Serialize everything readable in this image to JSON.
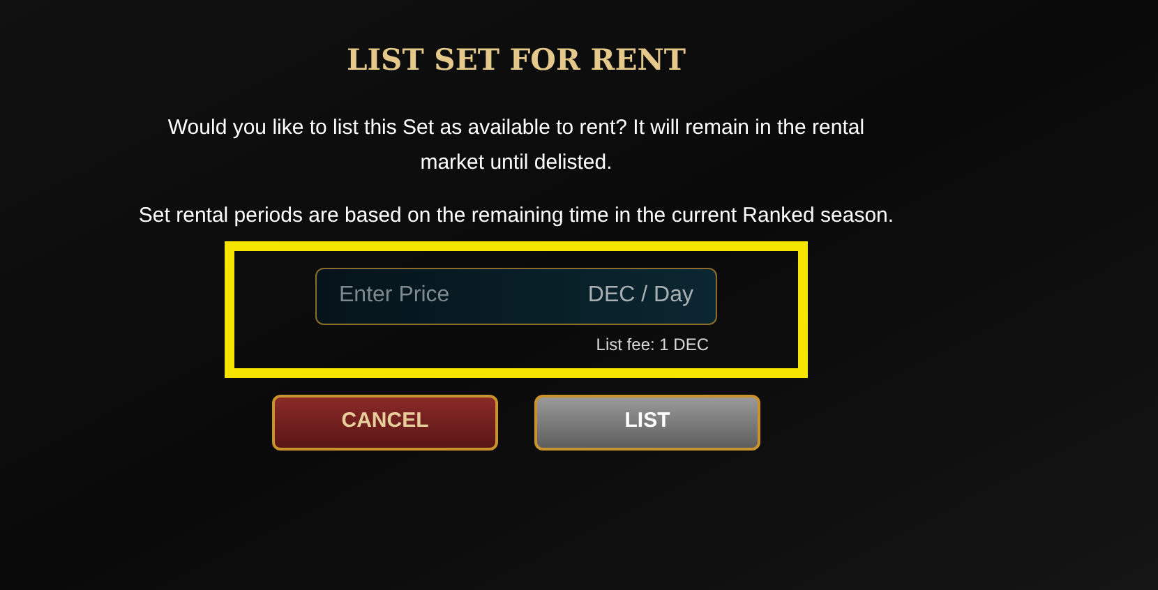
{
  "dialog": {
    "title": "LIST SET FOR RENT",
    "paragraphs": [
      "Would you like to list this Set as available to rent? It will remain in the rental market until delisted.",
      "Set rental periods are based on the remaining time in the current Ranked season."
    ],
    "price_field": {
      "placeholder": "Enter Price",
      "unit": "DEC / Day"
    },
    "fee": "List fee: 1 DEC",
    "highlighted": true,
    "buttons": [
      {
        "label": "CANCEL",
        "kind": "cancel"
      },
      {
        "label": "LIST",
        "kind": "confirm"
      }
    ]
  }
}
